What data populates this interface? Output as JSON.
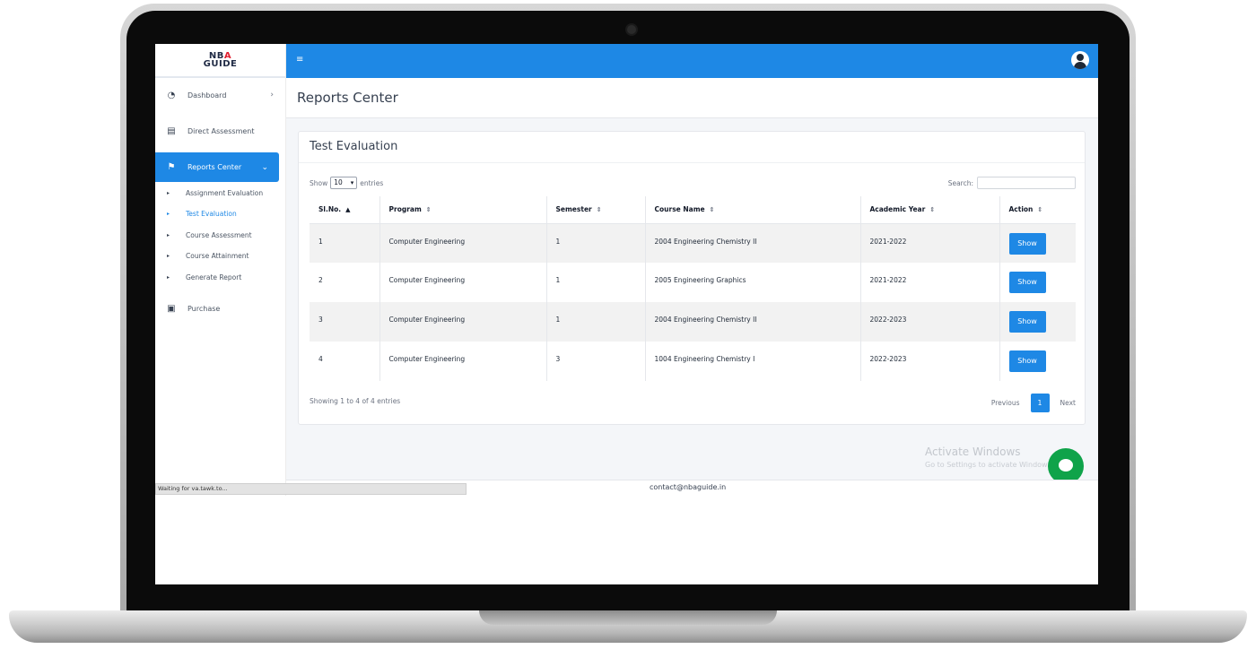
{
  "logo": {
    "line1_a": "NB",
    "line1_b": "A",
    "line2": "GUIDE"
  },
  "sidebar": {
    "items": [
      {
        "label": "Dashboard",
        "icon": "gauge-icon",
        "arrow": "›"
      },
      {
        "label": "Direct Assessment",
        "icon": "id-card-icon"
      },
      {
        "label": "Reports Center",
        "icon": "flag-icon",
        "arrow": "⌄"
      },
      {
        "label": "Purchase",
        "icon": "money-icon"
      }
    ],
    "sub_items": [
      "Assignment Evaluation",
      "Test Evaluation",
      "Course Assessment",
      "Course Attainment",
      "Generate Report"
    ]
  },
  "header": {
    "title": "Reports Center"
  },
  "card": {
    "title": "Test Evaluation",
    "show_label": "Show",
    "entries_value": "10",
    "entries_label": "entries",
    "search_label": "Search:",
    "columns": [
      "Sl.No.",
      "Program",
      "Semester",
      "Course Name",
      "Academic Year",
      "Action"
    ],
    "rows": [
      {
        "no": "1",
        "program": "Computer Engineering",
        "semester": "1",
        "course": "2004 Engineering Chemistry II",
        "year": "2021-2022",
        "action": "Show"
      },
      {
        "no": "2",
        "program": "Computer Engineering",
        "semester": "1",
        "course": "2005 Engineering Graphics",
        "year": "2021-2022",
        "action": "Show"
      },
      {
        "no": "3",
        "program": "Computer Engineering",
        "semester": "1",
        "course": "2004 Engineering Chemistry II",
        "year": "2022-2023",
        "action": "Show"
      },
      {
        "no": "4",
        "program": "Computer Engineering",
        "semester": "3",
        "course": "1004 Engineering Chemistry I",
        "year": "2022-2023",
        "action": "Show"
      }
    ],
    "info": "Showing 1 to 4 of 4 entries",
    "pagination": {
      "prev": "Previous",
      "page": "1",
      "next": "Next"
    }
  },
  "watermark": {
    "line1": "Activate Windows",
    "line2": "Go to Settings to activate Windows."
  },
  "footer": {
    "contact": "contact@nbaguide.in"
  },
  "statusbar": {
    "text": "Waiting for va.tawk.to..."
  },
  "colors": {
    "primary": "#1e88e5",
    "chat": "#0fa34a"
  }
}
